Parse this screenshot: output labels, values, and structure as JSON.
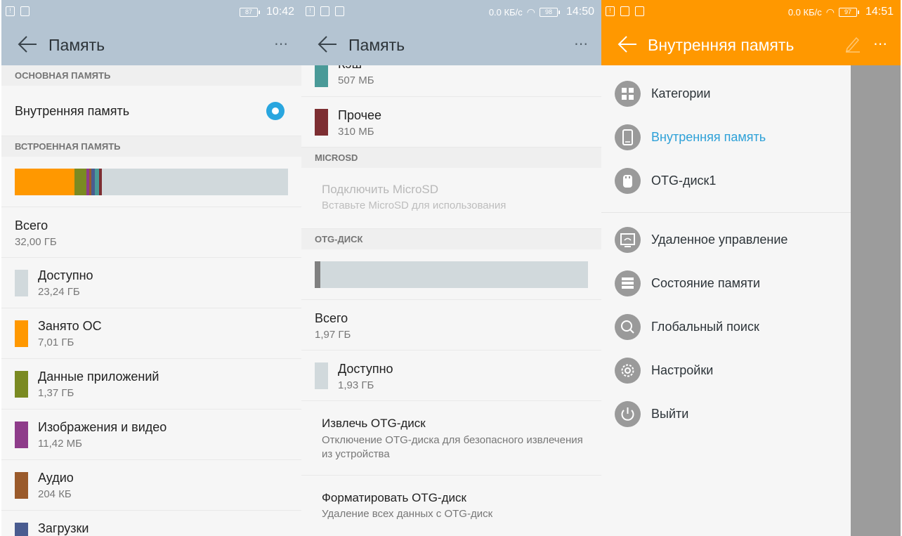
{
  "colors": {
    "toolbar_gray": "#b4c4d2",
    "toolbar_orange": "#ff9800",
    "accent_blue": "#29a6df",
    "bar_free": "#d1d9dc"
  },
  "panel1": {
    "status": {
      "battery": "87",
      "time": "10:42"
    },
    "toolbar": {
      "title": "Память",
      "more": "⋯"
    },
    "section_main": "ОСНОВНАЯ ПАМЯТЬ",
    "internal_memory_label": "Внутренняя память",
    "section_builtin": "ВСТРОЕННАЯ ПАМЯТЬ",
    "storage_segments": [
      {
        "name": "Занято ОС",
        "fraction": 0.219,
        "color": "#ff9800"
      },
      {
        "name": "Данные приложений",
        "fraction": 0.043,
        "color": "#7a8a22"
      },
      {
        "name": "Изображения и видео",
        "fraction": 0.01,
        "color": "#8e3c8a"
      },
      {
        "name": "Аудио",
        "fraction": 0.008,
        "color": "#9a5a2b"
      },
      {
        "name": "Загрузки",
        "fraction": 0.012,
        "color": "#4a5c90"
      },
      {
        "name": "Кэш",
        "fraction": 0.016,
        "color": "#4a9a98"
      },
      {
        "name": "Прочее",
        "fraction": 0.01,
        "color": "#7d2e32"
      }
    ],
    "total_label": "Всего",
    "total_value": "32,00 ГБ",
    "items": [
      {
        "label": "Доступно",
        "value": "23,24 ГБ",
        "color": "#d1d9dc"
      },
      {
        "label": "Занято ОС",
        "value": "7,01 ГБ",
        "color": "#ff9800"
      },
      {
        "label": "Данные приложений",
        "value": "1,37 ГБ",
        "color": "#7a8a22"
      },
      {
        "label": "Изображения и видео",
        "value": "11,42 МБ",
        "color": "#8e3c8a"
      },
      {
        "label": "Аудио",
        "value": "204 КБ",
        "color": "#9a5a2b"
      },
      {
        "label": "Загрузки",
        "value": "",
        "color": "#4a5c90"
      }
    ]
  },
  "panel2": {
    "status": {
      "speed": "0.0 КБ/с",
      "battery": "98",
      "time": "14:50"
    },
    "toolbar": {
      "title": "Память",
      "more": "⋯"
    },
    "cache": {
      "label": "Кэш",
      "value": "507 МБ",
      "color": "#4a9a98"
    },
    "other": {
      "label": "Прочее",
      "value": "310 МБ",
      "color": "#7d2e32"
    },
    "section_microsd": "MICROSD",
    "microsd_connect": "Подключить MicroSD",
    "microsd_hint": "Вставьте MicroSD для использования",
    "section_otg": "OTG-ДИСК",
    "otg_used_fraction": 0.02,
    "otg_used_color": "#808080",
    "total_label": "Всего",
    "total_value": "1,97 ГБ",
    "available": {
      "label": "Доступно",
      "value": "1,93 ГБ",
      "color": "#d1d9dc"
    },
    "eject": {
      "title": "Извлечь OTG-диск",
      "desc": "Отключение OTG-диска для безопасного извлечения из устройства"
    },
    "format": {
      "title": "Форматировать OTG-диск",
      "desc": "Удаление всех данных с OTG-диск"
    }
  },
  "panel3": {
    "status": {
      "speed": "0.0 КБ/с",
      "battery": "97",
      "time": "14:51"
    },
    "toolbar": {
      "title": "Внутренняя память",
      "more": "⋯"
    },
    "menu_top": [
      {
        "label": "Категории",
        "icon": "categories-icon"
      },
      {
        "label": "Внутренняя память",
        "icon": "phone-icon"
      },
      {
        "label": "OTG-диск1",
        "icon": "usb-icon"
      }
    ],
    "menu_bottom": [
      {
        "label": "Удаленное управление",
        "icon": "remote-icon"
      },
      {
        "label": "Состояние памяти",
        "icon": "storage-status-icon"
      },
      {
        "label": "Глобальный поиск",
        "icon": "search-icon"
      },
      {
        "label": "Настройки",
        "icon": "settings-icon"
      },
      {
        "label": "Выйти",
        "icon": "power-icon"
      }
    ]
  }
}
